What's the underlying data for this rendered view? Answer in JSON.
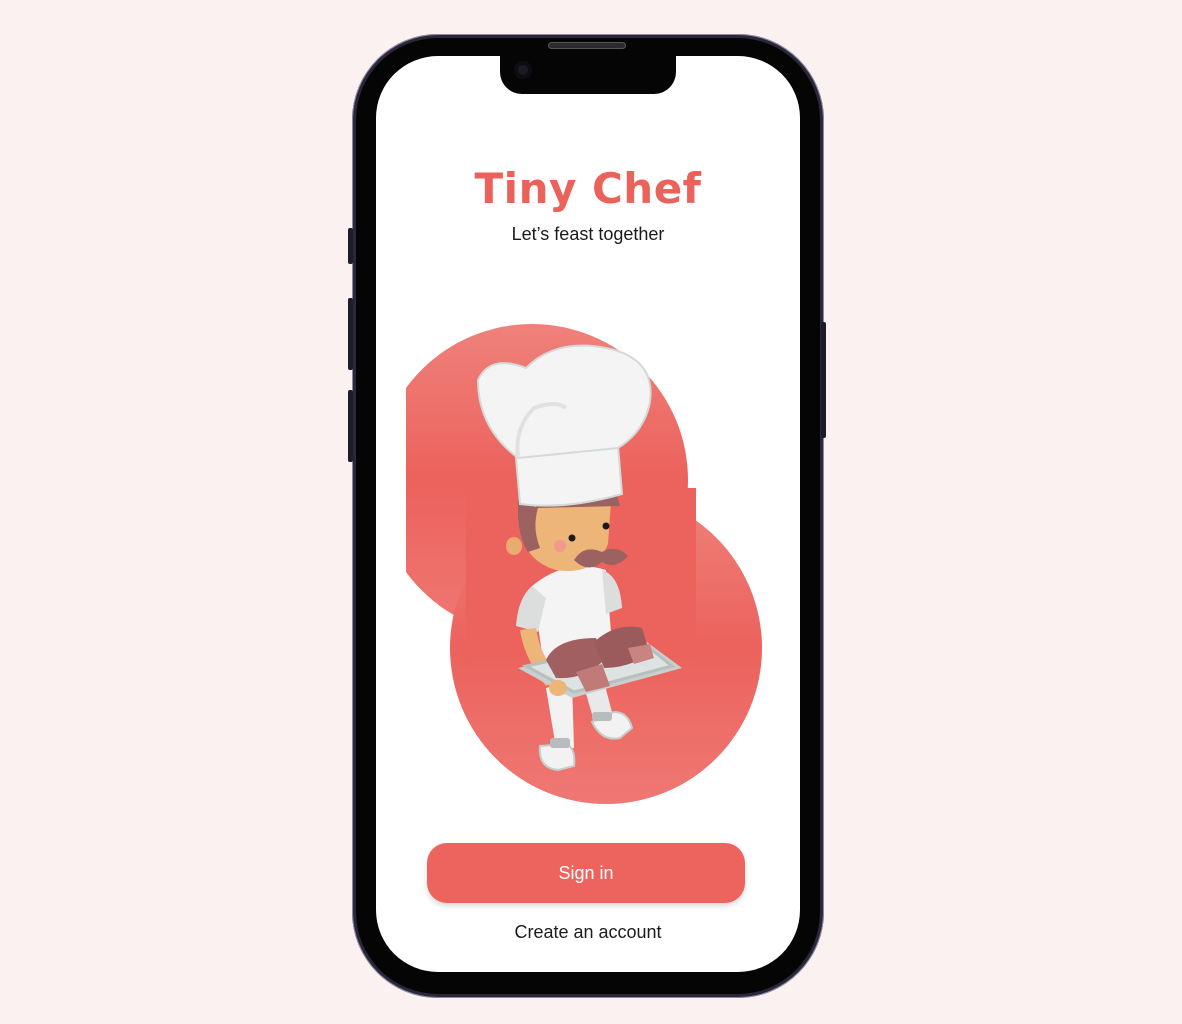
{
  "app": {
    "title": "Tiny Chef",
    "tagline": "Let’s feast together"
  },
  "actions": {
    "sign_in_label": "Sign in",
    "create_account_label": "Create an account"
  },
  "colors": {
    "brand": "#ea625a",
    "button": "#ec645d",
    "page_background": "#fbf1f1"
  },
  "illustration": {
    "icon": "chef-illustration"
  }
}
